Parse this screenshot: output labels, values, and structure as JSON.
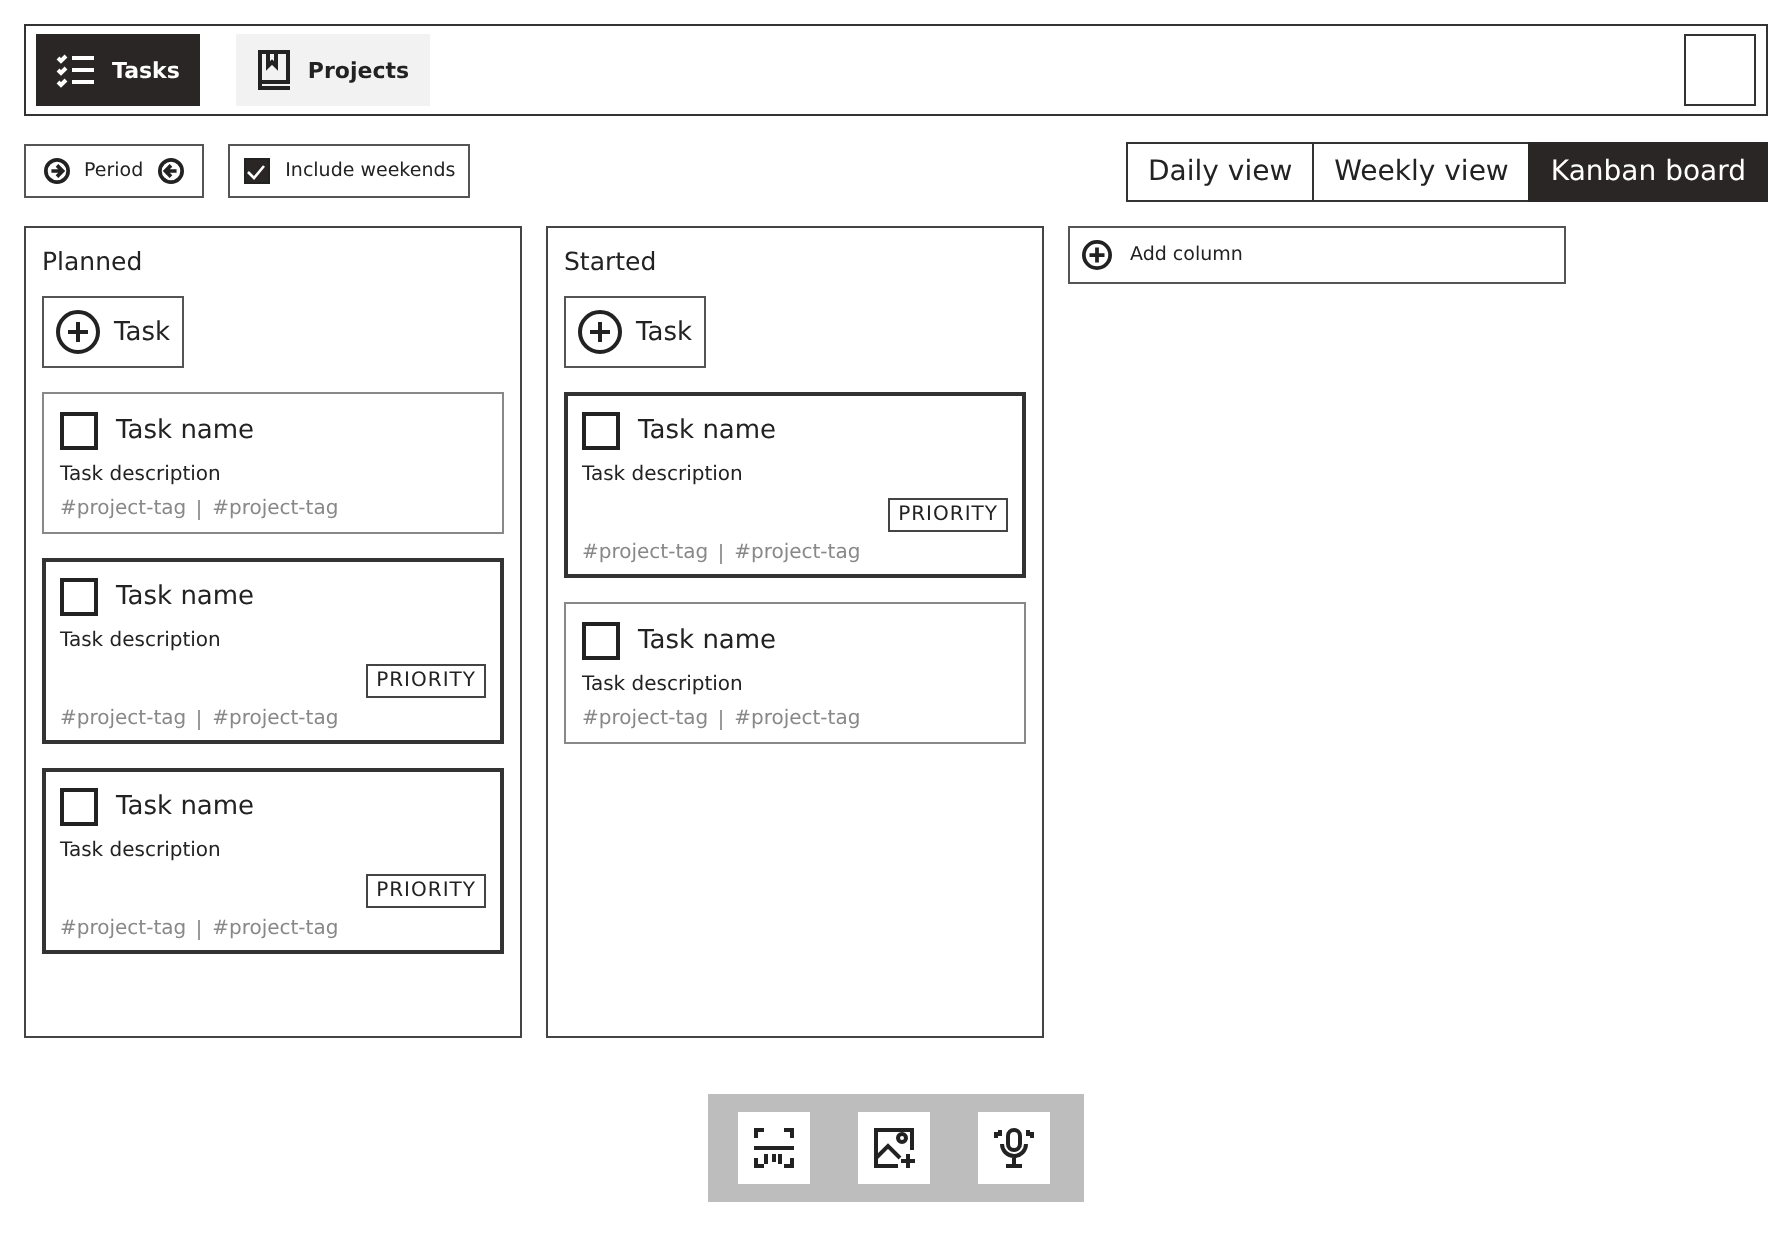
{
  "nav": {
    "tabs": [
      {
        "label": "Tasks",
        "kind": "list",
        "selected": true
      },
      {
        "label": "Projects",
        "kind": "book",
        "selected": false
      }
    ]
  },
  "toolbar": {
    "period": "Period",
    "weekends": {
      "label": "Include weekends",
      "checked": true
    },
    "views": [
      {
        "label": "Daily view",
        "selected": false
      },
      {
        "label": "Weekly view",
        "selected": false
      },
      {
        "label": "Kanban board",
        "selected": true
      }
    ]
  },
  "columns": [
    {
      "title": "Planned",
      "add_label": "Task",
      "cards": [
        {
          "name": "Task name",
          "checked": false,
          "description": "Task description",
          "tags": [
            "#project-tag",
            "#project-tag"
          ]
        },
        {
          "name": "Task name",
          "checked": false,
          "description": "Task description",
          "badge": "PRIORITY",
          "tags": [
            "#project-tag",
            "#project-tag"
          ]
        },
        {
          "name": "Task name",
          "checked": false,
          "description": "Task description",
          "badge": "PRIORITY",
          "tags": [
            "#project-tag",
            "#project-tag"
          ]
        }
      ]
    },
    {
      "title": "Started",
      "add_label": "Task",
      "cards": [
        {
          "name": "Task name",
          "checked": false,
          "description": "Task description",
          "badge": "PRIORITY",
          "tags": [
            "#project-tag",
            "#project-tag"
          ]
        },
        {
          "name": "Task name",
          "checked": false,
          "description": "Task description",
          "tags": [
            "#project-tag",
            "#project-tag"
          ]
        }
      ]
    }
  ],
  "add_column": "Add column",
  "bottom_tools": [
    {
      "kind": "scan"
    },
    {
      "kind": "image"
    },
    {
      "kind": "mic"
    }
  ]
}
